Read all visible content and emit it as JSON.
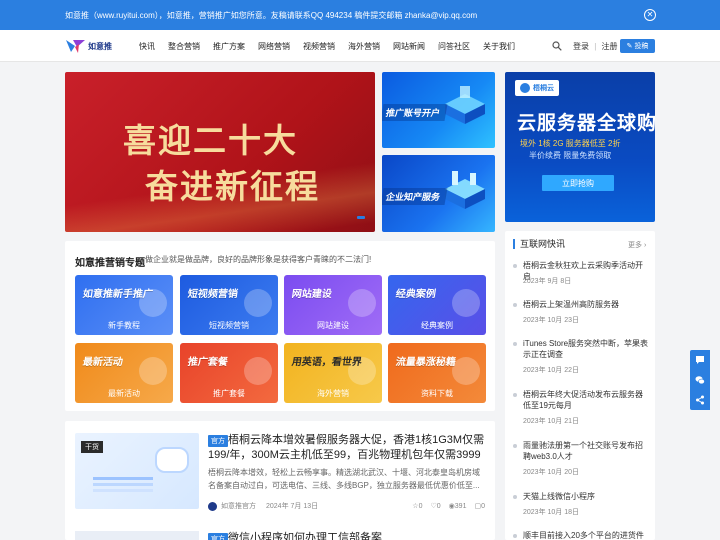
{
  "notice": {
    "text": "如意推（www.ruyitui.com），如意推，营销推广如您所意。友稿请联系QQ 494234 稿件提交邮箱 zhanka@vip.qq.com",
    "close_icon": "close-circle-icon"
  },
  "header": {
    "logo_text": "如意推",
    "nav": [
      "快讯",
      "整合营销",
      "推广方案",
      "网络营销",
      "视频营销",
      "海外营销",
      "网站新闻",
      "问答社区",
      "关于我们"
    ],
    "login": "登录",
    "separator": "|",
    "register": "注册",
    "post_button": "投稿"
  },
  "banners": {
    "main": {
      "line1": "喜迎二十大",
      "line2": "奋进新征程"
    },
    "small1": "推广账号开户",
    "small2": "企业知产服务",
    "ad": {
      "brand": "梧桐云",
      "headline": "云服务器全球购",
      "sub1": "境外 1核 2G 服务器低至 2折",
      "sub2": "半价续费 限量免费领取",
      "button": "立即抢购"
    }
  },
  "topics": {
    "title": "如意推营销专题",
    "subtitle": "做企业就是做品牌，良好的品牌形象是获得客户青睐的不二法门!",
    "cards": [
      {
        "title": "如意推新手推广",
        "label": "新手教程",
        "color": "#2f6ff0"
      },
      {
        "title": "短视频营销",
        "label": "短视频营销",
        "color": "#1d5be0"
      },
      {
        "title": "网站建设",
        "label": "网站建设",
        "color": "#7b4cf0"
      },
      {
        "title": "经典案例",
        "label": "经典案例",
        "color": "#3566ee"
      },
      {
        "title": "最新活动",
        "label": "最新活动",
        "color": "#f08a1a"
      },
      {
        "title": "推广套餐",
        "label": "推广套餐",
        "color": "#e8432a"
      },
      {
        "title": "用英语，看世界",
        "label": "海外营销",
        "color": "#f2b31f"
      },
      {
        "title": "流量暴涨秘籍",
        "label": "资料下载",
        "color": "#f06a1c"
      }
    ]
  },
  "articles": [
    {
      "tag": "干货",
      "category": "官方",
      "title": "梧桐云降本增效暑假服务器大促，香港1核1G3M仅需199/年，300M云主机低至99，百兆物理机包年仅需3999",
      "desc": "梧桐云降本增效，轻松上云畅享事。精选湖北武汉、十堰、河北泰皇岛机房域名备案自动过白，可选电信、三线、多线BGP，独立服务器最低优惠价低至...",
      "author": "如意推官方",
      "date": "2024年 7月 13日",
      "likes": "0",
      "thumbs": "0",
      "views": "391",
      "comments": "0"
    },
    {
      "category": "官方",
      "title": "微信小程序如何办理工信部备案"
    }
  ],
  "news": {
    "heading": "互联网快讯",
    "more": "更多",
    "items": [
      {
        "title": "梧桐云金秋狂欢上云采购季活动开启",
        "date": "2023年 9月 8日"
      },
      {
        "title": "梧桐云上架温州高防服务器",
        "date": "2023年 10月 23日"
      },
      {
        "title": "iTunes Store服务突然中断，苹果表示正在调查",
        "date": "2023年 10月 22日"
      },
      {
        "title": "梧桐云年终大促活动发布云服务器低至19元每月",
        "date": "2023年 10月 21日"
      },
      {
        "title": "雨量驰法册第一个社交账号发布招聘web3.0人才",
        "date": "2023年 10月 20日"
      },
      {
        "title": "天猫上线微信小程序",
        "date": "2023年 10月 18日"
      },
      {
        "title": "顺丰目前接入20多个平台的进货件业务",
        "date": ""
      }
    ]
  },
  "float_tools": [
    "chat-icon",
    "wechat-icon",
    "share-icon"
  ]
}
